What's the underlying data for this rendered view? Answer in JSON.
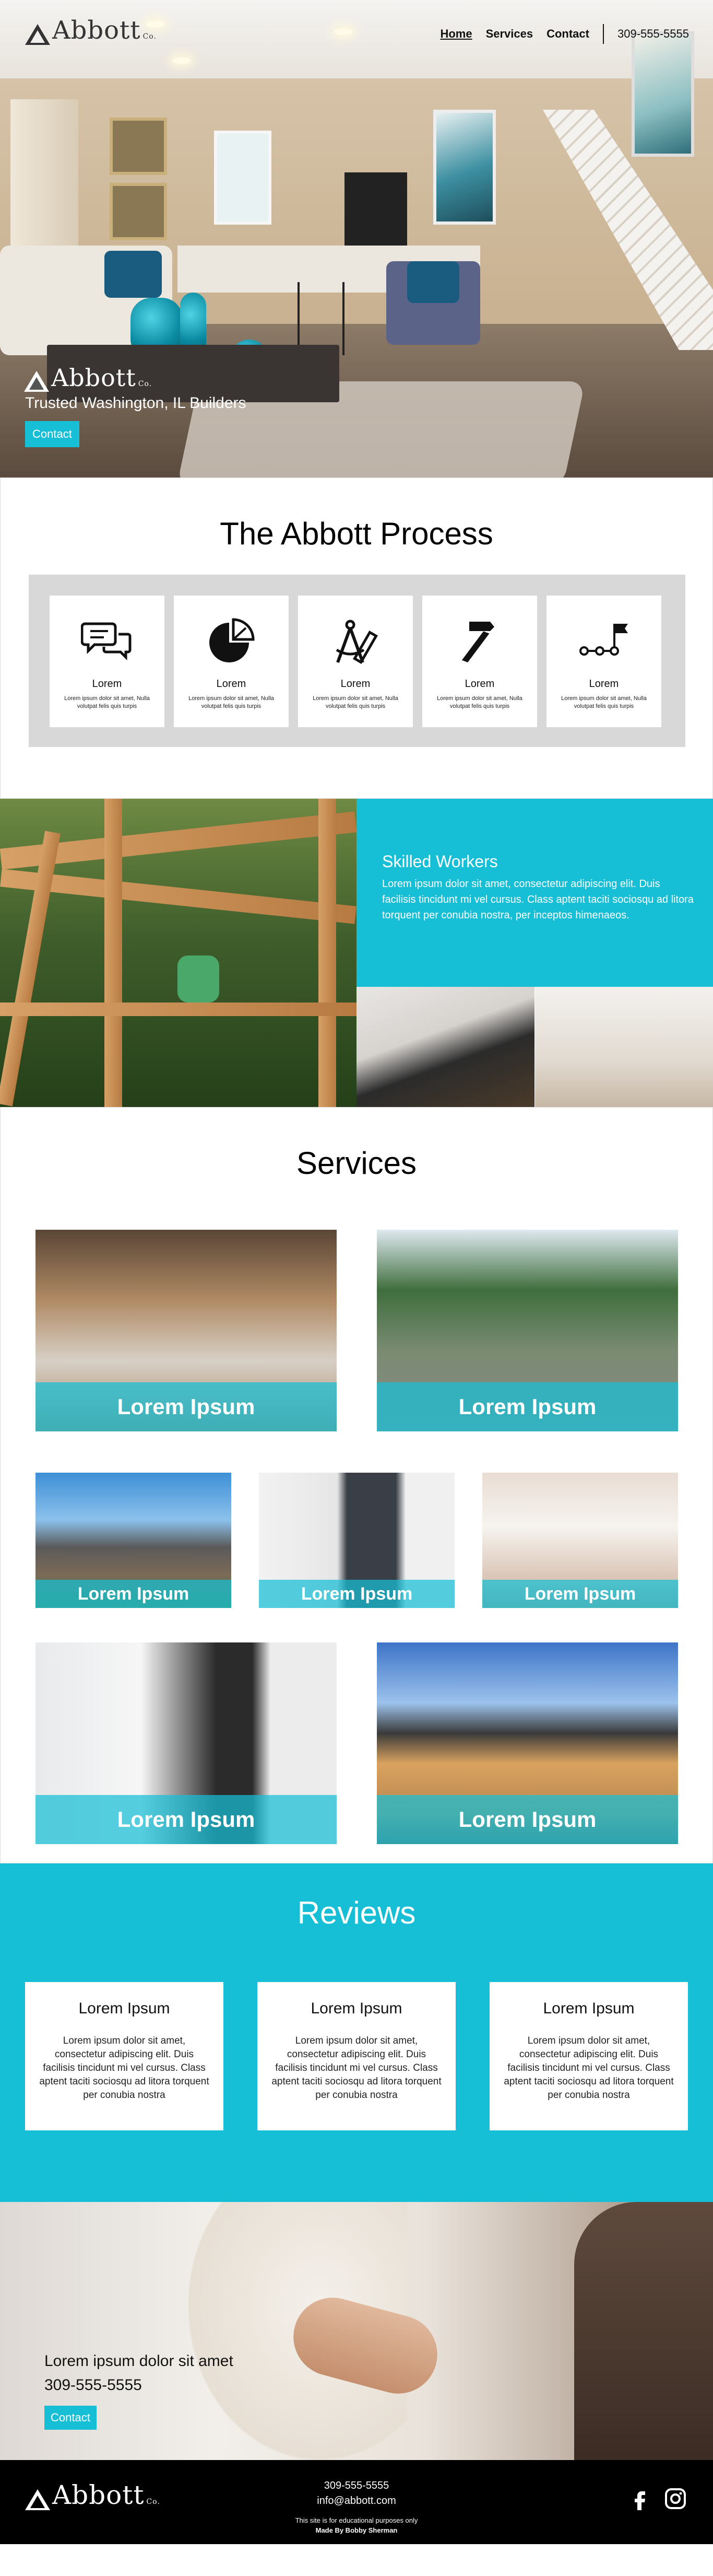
{
  "nav": {
    "logo": {
      "text": "Abbott",
      "suffix": "Co."
    },
    "links": [
      {
        "label": "Home"
      },
      {
        "label": "Services"
      },
      {
        "label": "Contact"
      }
    ],
    "phone": "309-555-5555"
  },
  "hero": {
    "logo": {
      "text": "Abbott",
      "suffix": "Co."
    },
    "tagline": "Trusted Washington, IL Builders",
    "button": "Contact"
  },
  "process": {
    "title": "The Abbott Process",
    "steps": [
      {
        "icon": "chat-bubbles-icon",
        "title": "Lorem",
        "text": "Lorem ipsum dolor sit amet, Nulla volutpat felis quis turpis"
      },
      {
        "icon": "pie-chart-icon",
        "title": "Lorem",
        "text": "Lorem ipsum dolor sit amet, Nulla volutpat felis quis turpis"
      },
      {
        "icon": "drafting-compass-icon",
        "title": "Lorem",
        "text": "Lorem ipsum dolor sit amet, Nulla volutpat felis quis turpis"
      },
      {
        "icon": "hammer-icon",
        "title": "Lorem",
        "text": "Lorem ipsum dolor sit amet, Nulla volutpat felis quis turpis"
      },
      {
        "icon": "milestone-flag-icon",
        "title": "Lorem",
        "text": "Lorem ipsum dolor sit amet, Nulla volutpat felis quis turpis"
      }
    ]
  },
  "skilled": {
    "title": "Skilled Workers",
    "text": "Lorem ipsum dolor sit amet, consectetur adipiscing elit. Duis facilisis tincidunt mi vel cursus. Class aptent taciti sociosqu ad litora torquent per conubia nostra, per inceptos himenaeos."
  },
  "services": {
    "title": "Services",
    "items": [
      {
        "label": "Lorem Ipsum"
      },
      {
        "label": "Lorem Ipsum"
      },
      {
        "label": "Lorem Ipsum"
      },
      {
        "label": "Lorem Ipsum"
      },
      {
        "label": "Lorem Ipsum"
      },
      {
        "label": "Lorem Ipsum"
      },
      {
        "label": "Lorem Ipsum"
      }
    ]
  },
  "reviews": {
    "title": "Reviews",
    "items": [
      {
        "title": "Lorem Ipsum",
        "text": "Lorem ipsum dolor sit amet, consectetur adipiscing elit. Duis facilisis tincidunt mi vel cursus. Class aptent taciti sociosqu ad litora torquent per conubia nostra"
      },
      {
        "title": "Lorem Ipsum",
        "text": "Lorem ipsum dolor sit amet, consectetur adipiscing elit. Duis facilisis tincidunt mi vel cursus. Class aptent taciti sociosqu ad litora torquent per conubia nostra"
      },
      {
        "title": "Lorem Ipsum",
        "text": "Lorem ipsum dolor sit amet, consectetur adipiscing elit. Duis facilisis tincidunt mi vel cursus. Class aptent taciti sociosqu ad litora torquent per conubia nostra"
      }
    ]
  },
  "contact": {
    "text": "Lorem ipsum dolor sit amet",
    "phone": "309-555-5555",
    "button": "Contact"
  },
  "footer": {
    "logo": {
      "text": "Abbott",
      "suffix": "Co."
    },
    "phone": "309-555-5555",
    "email": "info@abbott.com",
    "note": "This site is for educational purposes only",
    "credit": "Made By Bobby Sherman",
    "social": [
      "facebook-icon",
      "instagram-icon"
    ]
  },
  "colors": {
    "accent": "#16bfd6",
    "footer": "#000000",
    "process_box": "#d8d8d8"
  }
}
